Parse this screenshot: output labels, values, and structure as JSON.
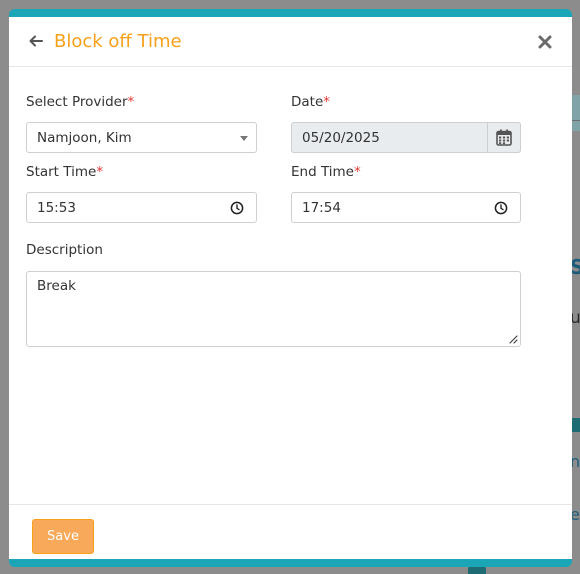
{
  "modal": {
    "title": "Block off Time",
    "icons": {
      "back": "arrow-left-icon",
      "close": "close-x-icon"
    }
  },
  "form": {
    "provider": {
      "label": "Select Provider",
      "required_mark": "*",
      "value": "Namjoon, Kim"
    },
    "date": {
      "label": "Date",
      "required_mark": "*",
      "value": "05/20/2025",
      "disabled": true,
      "icon": "calendar-icon"
    },
    "start_time": {
      "label": "Start Time",
      "required_mark": "*",
      "value": "15:53",
      "icon": "clock-icon"
    },
    "end_time": {
      "label": "End Time",
      "required_mark": "*",
      "value": "17:54",
      "icon": "clock-icon"
    },
    "description": {
      "label": "Description",
      "value": "Break"
    }
  },
  "footer": {
    "save_label": "Save"
  },
  "colors": {
    "accent_teal": "#1aa6b7",
    "title_orange": "#f7a01a",
    "save_button": "#f9a95a",
    "required_red": "#e53935"
  }
}
